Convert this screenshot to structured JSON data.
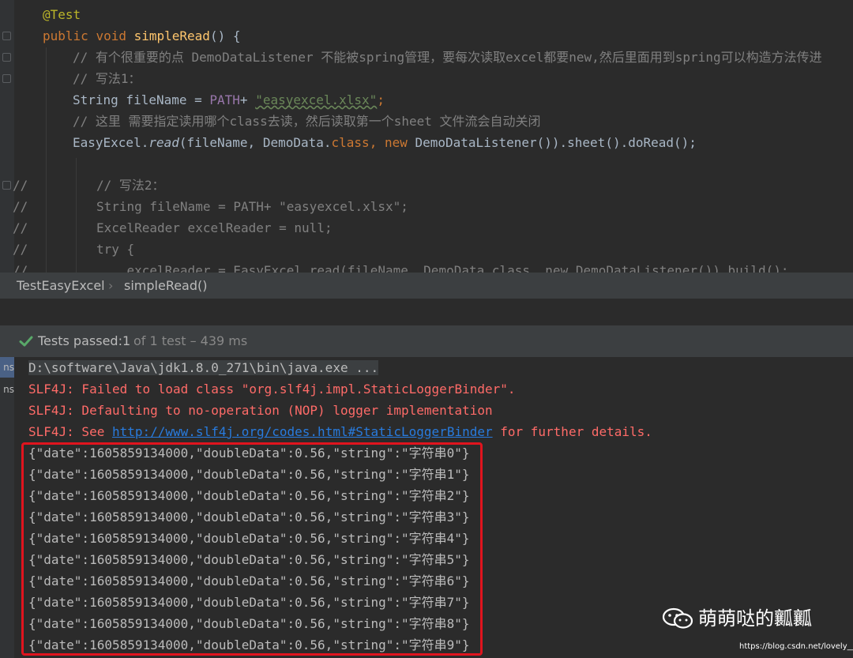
{
  "editor": {
    "annotation": "@Test",
    "method_kw1": "public",
    "method_kw2": "void",
    "method_name": "simpleRead",
    "method_rest": "() {",
    "comment1": "// 有个很重要的点 DemoDataListener 不能被spring管理，要每次读取excel都要new,然后里面用到spring可以构造方法传进",
    "comment2": "// 写法1：",
    "decl_type": "String fileName = ",
    "decl_const": "PATH",
    "decl_plus": "+ ",
    "decl_string": "\"easyexcel.xlsx\"",
    "decl_end": ";",
    "comment3": "// 这里 需要指定读用哪个class去读，然后读取第一个sheet 文件流会自动关闭",
    "call_obj": "EasyExcel.",
    "call_method": "read",
    "call_args1": "(fileName, DemoData.",
    "call_class_kw": "class",
    "call_comma": ", ",
    "call_new": "new",
    "call_rest": " DemoDataListener()).sheet().doRead();",
    "commented": [
      "//         // 写法2：",
      "//         String fileName = PATH+ \"easyexcel.xlsx\";",
      "//         ExcelReader excelReader = null;",
      "//         try {",
      "//             excelReader = EasyExcel.read(fileName, DemoData.class, new DemoDataListener()).build();"
    ]
  },
  "breadcrumb": {
    "class_name": "TestEasyExcel",
    "method": "simpleRead()"
  },
  "test_status": {
    "passed_label": "Tests passed:",
    "passed_count": "1",
    "detail": "of 1 test – 439 ms"
  },
  "console": {
    "sidebar_tabs": [
      "ns",
      "ns"
    ],
    "command": "D:\\software\\Java\\jdk1.8.0_271\\bin\\java.exe ...",
    "errors": [
      "SLF4J: Failed to load class \"org.slf4j.impl.StaticLoggerBinder\".",
      "SLF4J: Defaulting to no-operation (NOP) logger implementation"
    ],
    "see_prefix": "SLF4J: See ",
    "see_link": "http://www.slf4j.org/codes.html#StaticLoggerBinder",
    "see_suffix": " for further details.",
    "output": [
      "{\"date\":1605859134000,\"doubleData\":0.56,\"string\":\"字符串0\"}",
      "{\"date\":1605859134000,\"doubleData\":0.56,\"string\":\"字符串1\"}",
      "{\"date\":1605859134000,\"doubleData\":0.56,\"string\":\"字符串2\"}",
      "{\"date\":1605859134000,\"doubleData\":0.56,\"string\":\"字符串3\"}",
      "{\"date\":1605859134000,\"doubleData\":0.56,\"string\":\"字符串4\"}",
      "{\"date\":1605859134000,\"doubleData\":0.56,\"string\":\"字符串5\"}",
      "{\"date\":1605859134000,\"doubleData\":0.56,\"string\":\"字符串6\"}",
      "{\"date\":1605859134000,\"doubleData\":0.56,\"string\":\"字符串7\"}",
      "{\"date\":1605859134000,\"doubleData\":0.56,\"string\":\"字符串8\"}",
      "{\"date\":1605859134000,\"doubleData\":0.56,\"string\":\"字符串9\"}"
    ]
  },
  "watermark": {
    "icon": "wechat-icon",
    "text": "萌萌哒的瓤瓤",
    "url": "https://blog.csdn.net/lovely__RR"
  }
}
